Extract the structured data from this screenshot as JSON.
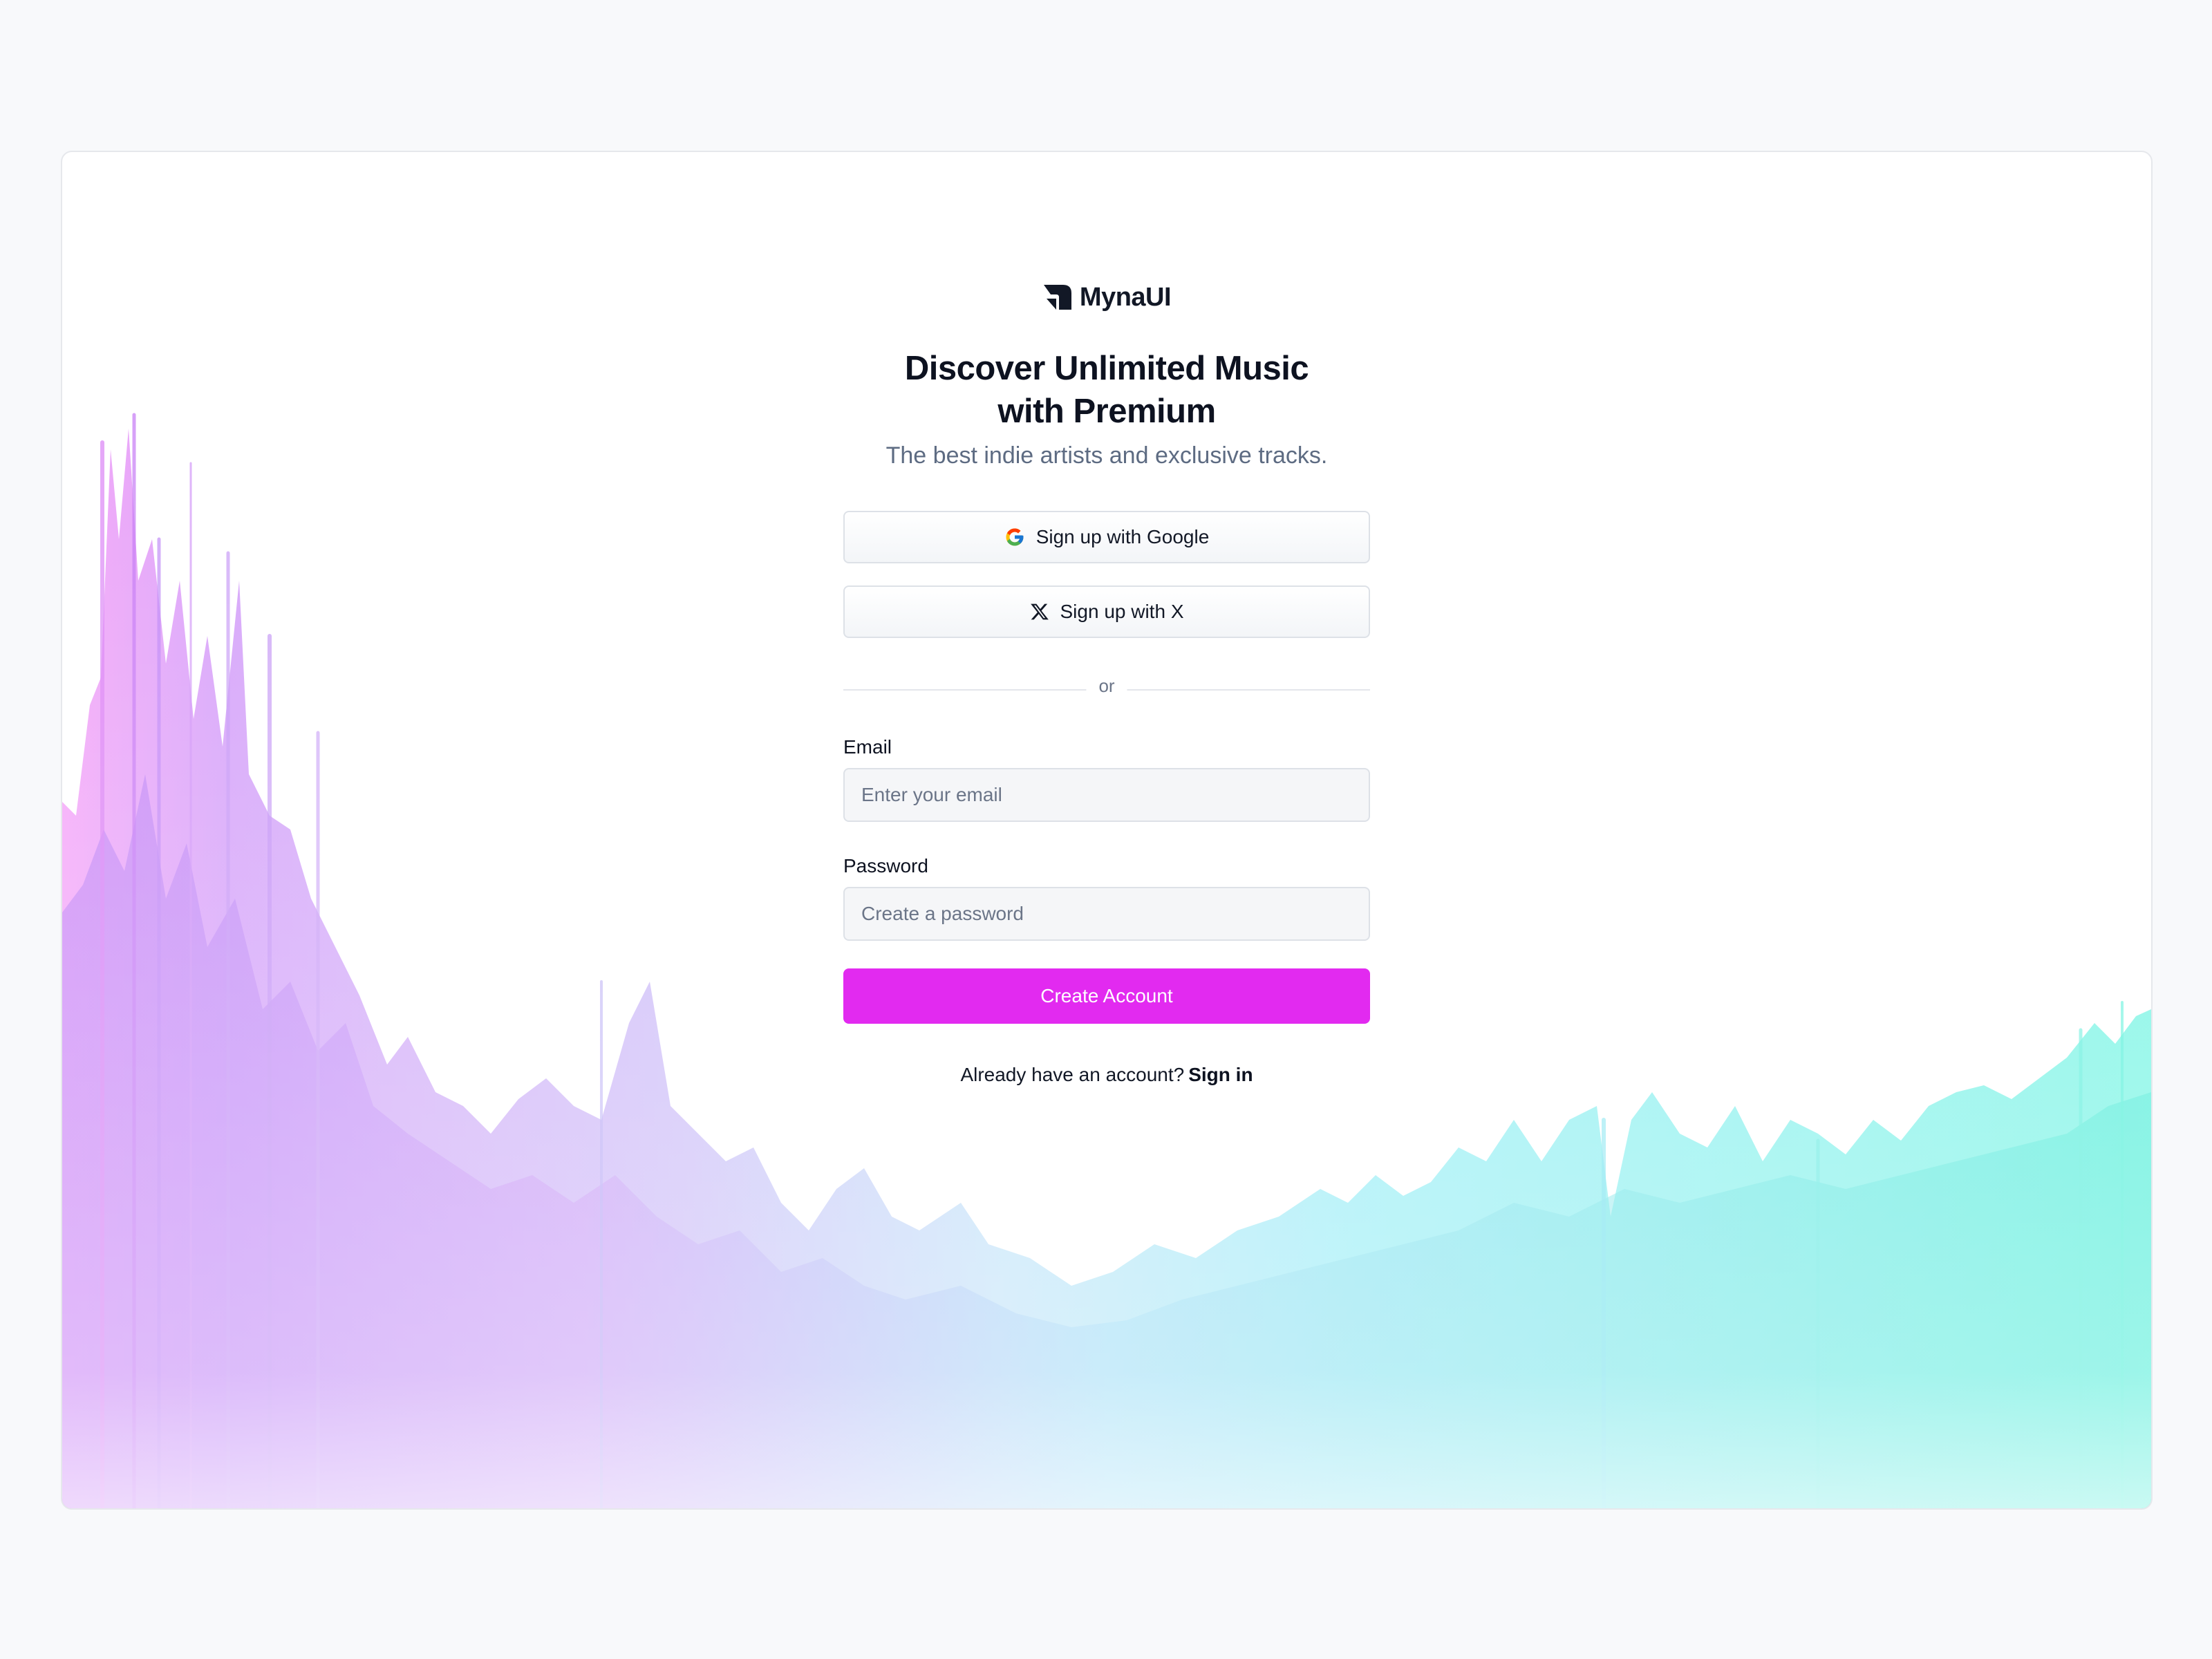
{
  "brand": {
    "name": "MynaUI"
  },
  "hero": {
    "title_line1": "Discover Unlimited Music",
    "title_line2": "with Premium",
    "subtitle": "The best indie artists and exclusive tracks."
  },
  "social": {
    "google_label": "Sign up with Google",
    "x_label": "Sign up with X"
  },
  "divider_text": "or",
  "form": {
    "email_label": "Email",
    "email_placeholder": "Enter your email",
    "password_label": "Password",
    "password_placeholder": "Create a password",
    "submit_label": "Create Account"
  },
  "footer": {
    "prompt": "Already have an account?",
    "link": "Sign in"
  },
  "colors": {
    "accent": "#e22af0",
    "wave_left": "#c86cf5",
    "wave_right": "#3ef0d8",
    "page_bg": "#f8f9fb"
  },
  "icons": {
    "logo": "myna-logo-icon",
    "google": "google-icon",
    "x": "x-icon"
  }
}
